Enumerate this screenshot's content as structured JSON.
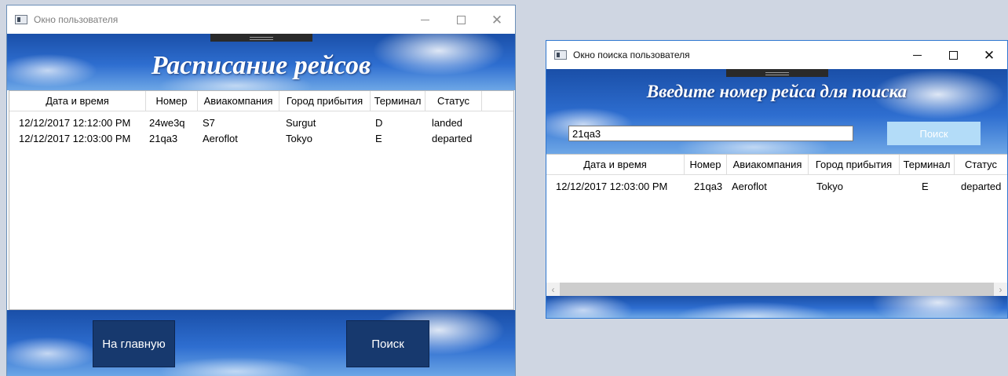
{
  "user_window": {
    "title": "Окно пользователя",
    "heading": "Расписание рейсов",
    "columns": [
      "Дата и время",
      "Номер",
      "Авиакомпания",
      "Город прибытия",
      "Терминал",
      "Статус"
    ],
    "rows": [
      [
        "12/12/2017 12:12:00 PM",
        "24we3q",
        "S7",
        "Surgut",
        "D",
        "landed"
      ],
      [
        "12/12/2017 12:03:00 PM",
        "21qa3",
        "Aeroflot",
        "Tokyo",
        "E",
        "departed"
      ]
    ],
    "home_button": "На главную",
    "search_button": "Поиск"
  },
  "search_window": {
    "title": "Окно поиска пользователя",
    "heading": "Введите номер рейса для поиска",
    "search_value": "21qa3",
    "search_button": "Поиск",
    "columns": [
      "Дата и время",
      "Номер",
      "Авиакомпания",
      "Город прибытия",
      "Терминал",
      "Статус"
    ],
    "rows": [
      [
        "12/12/2017 12:03:00 PM",
        "21qa3",
        "Aeroflot",
        "Tokyo",
        "E",
        "departed"
      ]
    ]
  },
  "icons": {
    "minimize": "minimize-icon",
    "maximize": "maximize-icon",
    "close": "close-icon",
    "app": "app-window-icon"
  },
  "colors": {
    "dark_button": "#17396e",
    "search_button_light": "#b3dcf8",
    "sky_blue": "#2e6ed0"
  }
}
